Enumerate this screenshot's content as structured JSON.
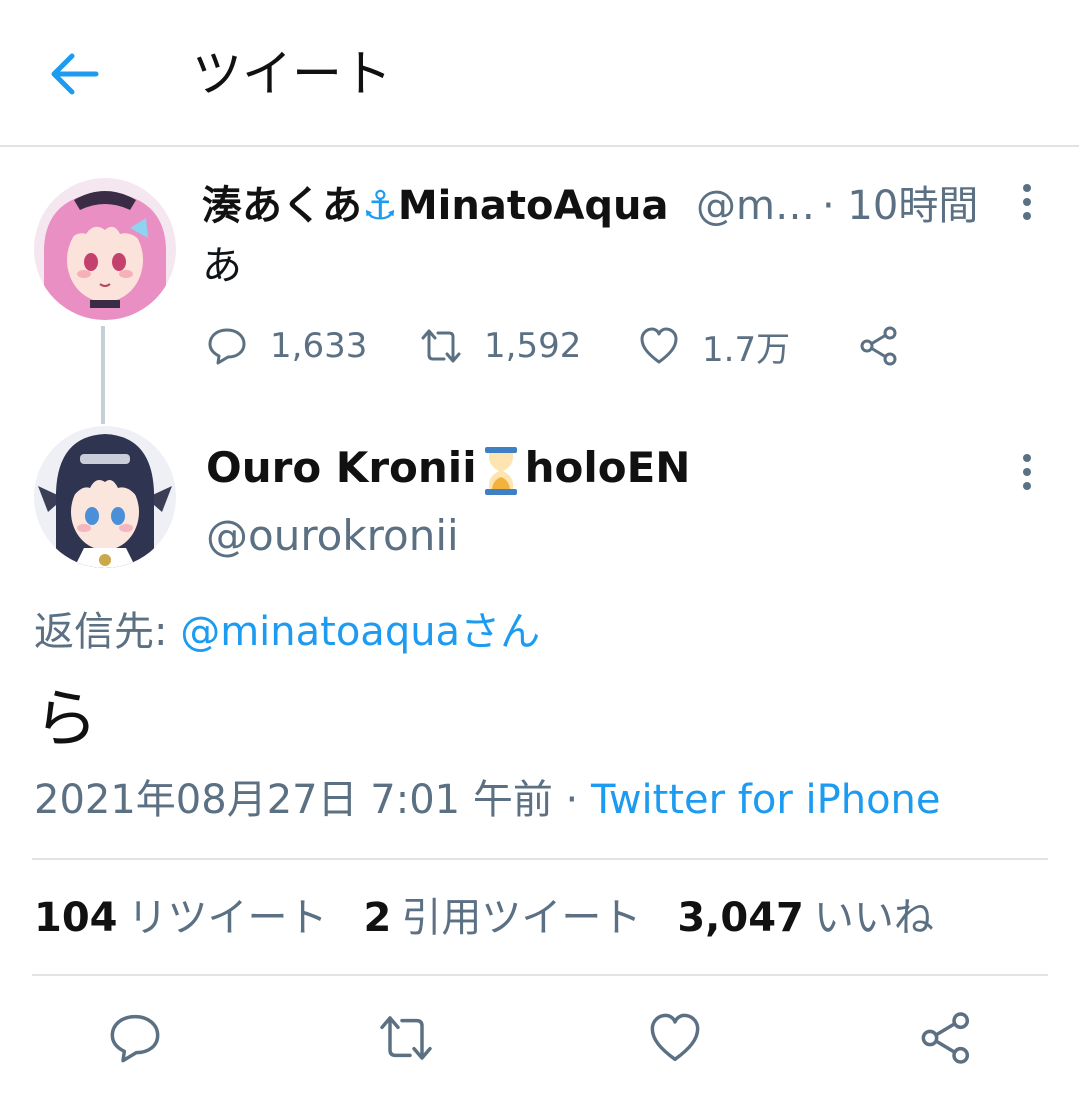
{
  "header": {
    "title": "ツイート"
  },
  "parent_tweet": {
    "display_name": "湊あくあ",
    "name_emoji": "⚓",
    "display_name_suffix": "MinatoAqua",
    "handle": "@m…",
    "time": "· 10時間",
    "text": "あ",
    "replies": "1,633",
    "retweets": "1,592",
    "likes": "1.7万"
  },
  "reply_tweet": {
    "display_name": "Ouro Kronii",
    "display_name_suffix": "holoEN",
    "handle": "@ourokronii",
    "reply_to_label": "返信先: ",
    "reply_to_mention": "@minatoaquaさん",
    "text": "ら",
    "timestamp": "2021年08月27日 7:01 午前 · ",
    "source": "Twitter for iPhone"
  },
  "stats": {
    "retweets_count": "104",
    "retweets_label": "リツイート",
    "quotes_count": "2",
    "quotes_label": "引用ツイート",
    "likes_count": "3,047",
    "likes_label": "いいね"
  },
  "colors": {
    "accent": "#1d9bf0",
    "secondary_text": "#5b7083",
    "divider": "#e1e4e7"
  },
  "icons": {
    "back": "arrow-left-icon",
    "more": "more-vertical-icon",
    "reply": "comment-icon",
    "retweet": "retweet-icon",
    "like": "heart-icon",
    "share": "share-icon",
    "hourglass": "hourglass-icon"
  }
}
